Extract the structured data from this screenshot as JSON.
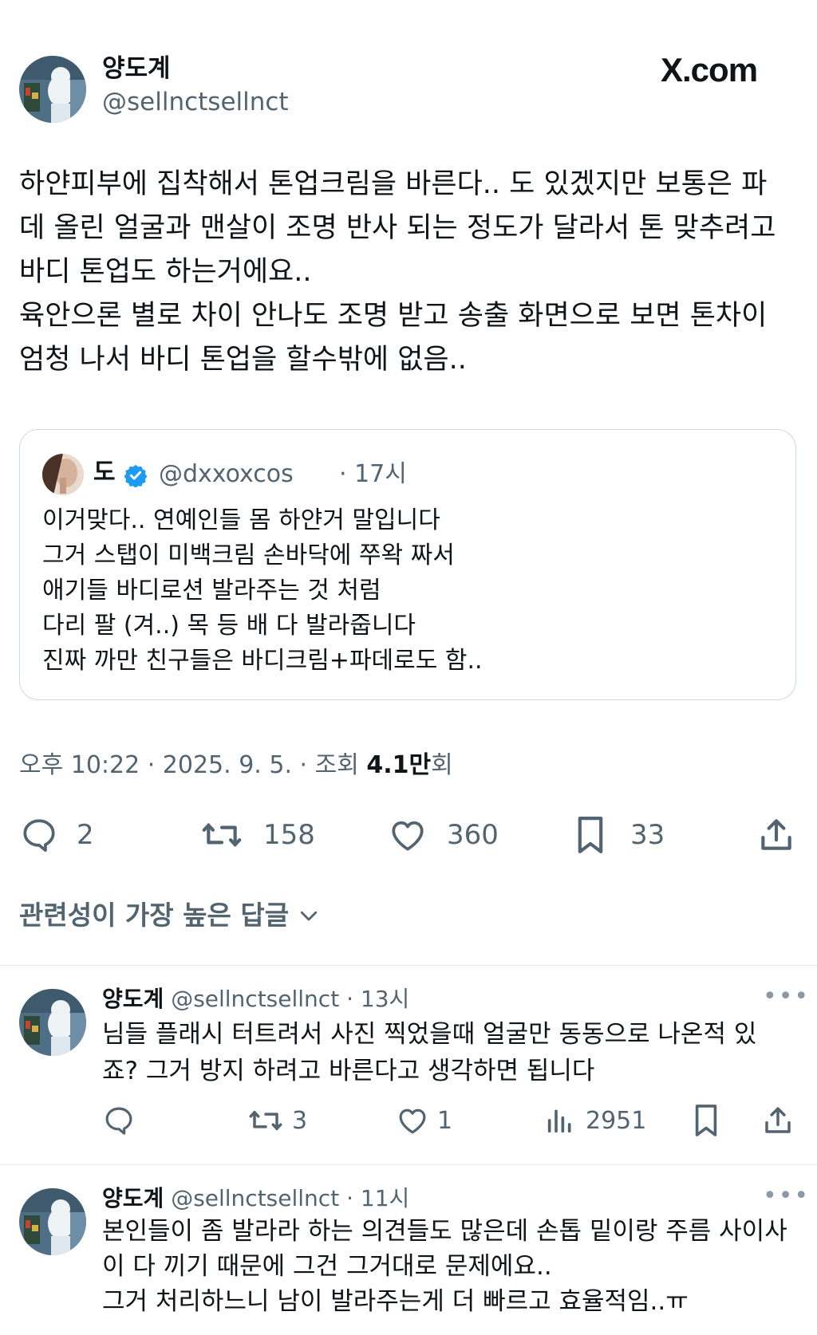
{
  "header": {
    "display_name": "양도계",
    "handle": "@sellnctsellnct",
    "brand": "X.com"
  },
  "post": {
    "text_lines": [
      "하얀피부에 집착해서 톤업크림을 바른다.. 도 있겠지만 보통은 파",
      "데 올린 얼굴과 맨살이 조명 반사 되는 정도가 달라서 톤 맞추려고",
      "바디 톤업도 하는거에요..",
      "육안으론 별로 차이 안나도 조명 받고 송출 화면으로 보면 톤차이",
      "엄청 나서 바디 톤업을 할수밖에 없음.."
    ],
    "quote": {
      "name": "도",
      "handle": "@dxxoxcos",
      "time": "· 17시",
      "lines": [
        "이거맞다.. 연예인들 몸 하얀거 말입니다",
        "그거 스탭이 미백크림 손바닥에 쭈왁 짜서",
        "애기들 바디로션 발라주는 것 처럼",
        "다리 팔 (겨..) 목 등 배 다 발라줍니다",
        "진짜 까만 친구들은 바디크림+파데로도 함.."
      ]
    },
    "meta": {
      "time": "오후 10:22 · 2025. 9. 5. · 조회 ",
      "views": "4.1만",
      "views_suffix": "회"
    },
    "actions": {
      "replies": "2",
      "reposts": "158",
      "likes": "360",
      "bookmarks": "33"
    }
  },
  "sort_label": "관련성이 가장 높은 답글",
  "replies": [
    {
      "name": "양도계",
      "handle": "@sellnctsellnct · 13시",
      "lines": [
        "님들 플래시 터트려서 사진 찍었을때 얼굴만 동동으로 나온적 있",
        "죠? 그거 방지 하려고 바른다고 생각하면 됩니다"
      ],
      "reposts": "3",
      "likes": "1",
      "views": "2951"
    },
    {
      "name": "양도계",
      "handle": "@sellnctsellnct · 11시",
      "lines": [
        "본인들이 좀 발라라 하는 의견들도 많은데 손톱 밑이랑 주름 사이사",
        "이 다 끼기 때문에 그건 그거대로 문제에요..",
        "그거 처리하느니 남이 발라주는게 더 빠르고 효율적임..ㅠ"
      ]
    }
  ],
  "colors": {
    "text": "#0f1419",
    "secondary": "#536471",
    "verified": "#1d9bf0",
    "border": "#e6e8ea"
  }
}
